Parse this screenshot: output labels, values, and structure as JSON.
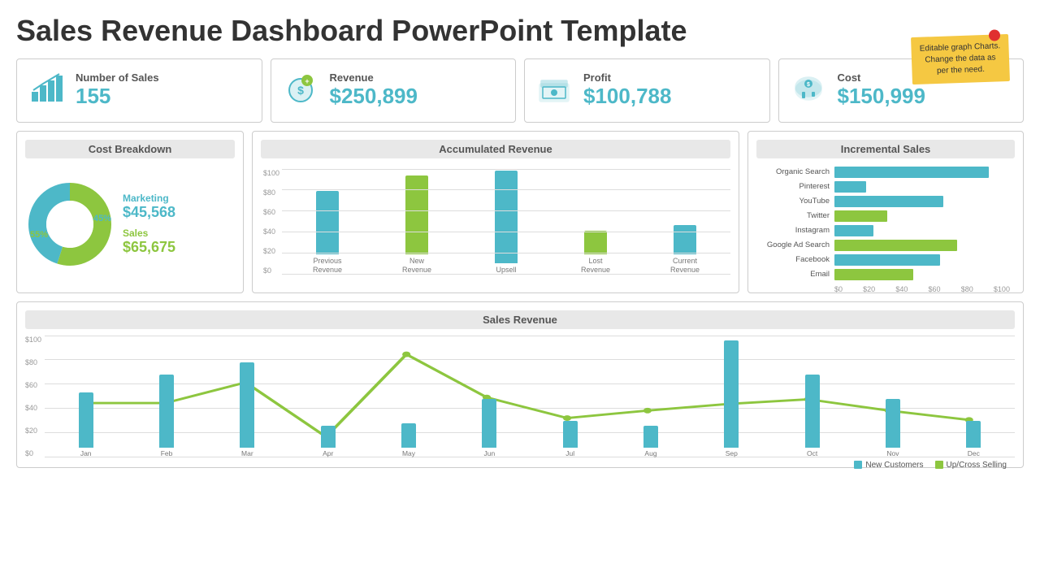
{
  "title": "Sales Revenue Dashboard PowerPoint Template",
  "note": "Editable graph Charts. Change the data as per the need.",
  "kpis": [
    {
      "label": "Number of Sales",
      "value": "155",
      "icon": "📊"
    },
    {
      "label": "Revenue",
      "value": "$250,899",
      "icon": "💼"
    },
    {
      "label": "Profit",
      "value": "$100,788",
      "icon": "💵"
    },
    {
      "label": "Cost",
      "value": "$150,999",
      "icon": "🐷"
    }
  ],
  "cost_breakdown": {
    "title": "Cost Breakdown",
    "marketing_label": "Marketing",
    "marketing_value": "$45,568",
    "sales_label": "Sales",
    "sales_value": "$65,675",
    "pct_teal": 45,
    "pct_green": 55
  },
  "accumulated_revenue": {
    "title": "Accumulated Revenue",
    "y_labels": [
      "$100",
      "$80",
      "$60",
      "$40",
      "$20",
      "$0"
    ],
    "bars": [
      {
        "label": "Previous\nRevenue",
        "height_teal": 60,
        "height_green": 0
      },
      {
        "label": "New\nRevenue",
        "height_teal": 0,
        "height_green": 75
      },
      {
        "label": "Upsell",
        "height_teal": 88,
        "height_green": 0
      },
      {
        "label": "Lost\nRevenue",
        "height_teal": 0,
        "height_green": 22
      },
      {
        "label": "Current\nRevenue",
        "height_teal": 28,
        "height_green": 0
      }
    ]
  },
  "incremental_sales": {
    "title": "Incremental Sales",
    "items": [
      {
        "label": "Organic Search",
        "value": 88,
        "color": "teal"
      },
      {
        "label": "Pinterest",
        "value": 18,
        "color": "teal"
      },
      {
        "label": "YouTube",
        "value": 62,
        "color": "teal"
      },
      {
        "label": "Twitter",
        "value": 30,
        "color": "green"
      },
      {
        "label": "Instagram",
        "value": 22,
        "color": "teal"
      },
      {
        "label": "Google Ad Search",
        "value": 70,
        "color": "green"
      },
      {
        "label": "Facebook",
        "value": 60,
        "color": "teal"
      },
      {
        "label": "Email",
        "value": 45,
        "color": "green"
      }
    ],
    "x_labels": [
      "$0",
      "$20",
      "$40",
      "$60",
      "$80",
      "$100"
    ]
  },
  "sales_revenue": {
    "title": "Sales Revenue",
    "y_labels": [
      "$100",
      "$80",
      "$60",
      "$40",
      "$20",
      "$0"
    ],
    "months": [
      "Jan",
      "Feb",
      "Mar",
      "Apr",
      "May",
      "Jun",
      "Jul",
      "Aug",
      "Sep",
      "Oct",
      "Nov",
      "Dec"
    ],
    "bar_values": [
      45,
      60,
      70,
      18,
      20,
      40,
      22,
      18,
      88,
      60,
      40,
      22
    ],
    "line_values": [
      48,
      48,
      80,
      28,
      85,
      56,
      38,
      45,
      52,
      55,
      45,
      38
    ],
    "legend": [
      {
        "label": "New Customers",
        "color": "#4db8c8"
      },
      {
        "label": "Up/Cross Selling",
        "color": "#8dc63f"
      }
    ]
  }
}
